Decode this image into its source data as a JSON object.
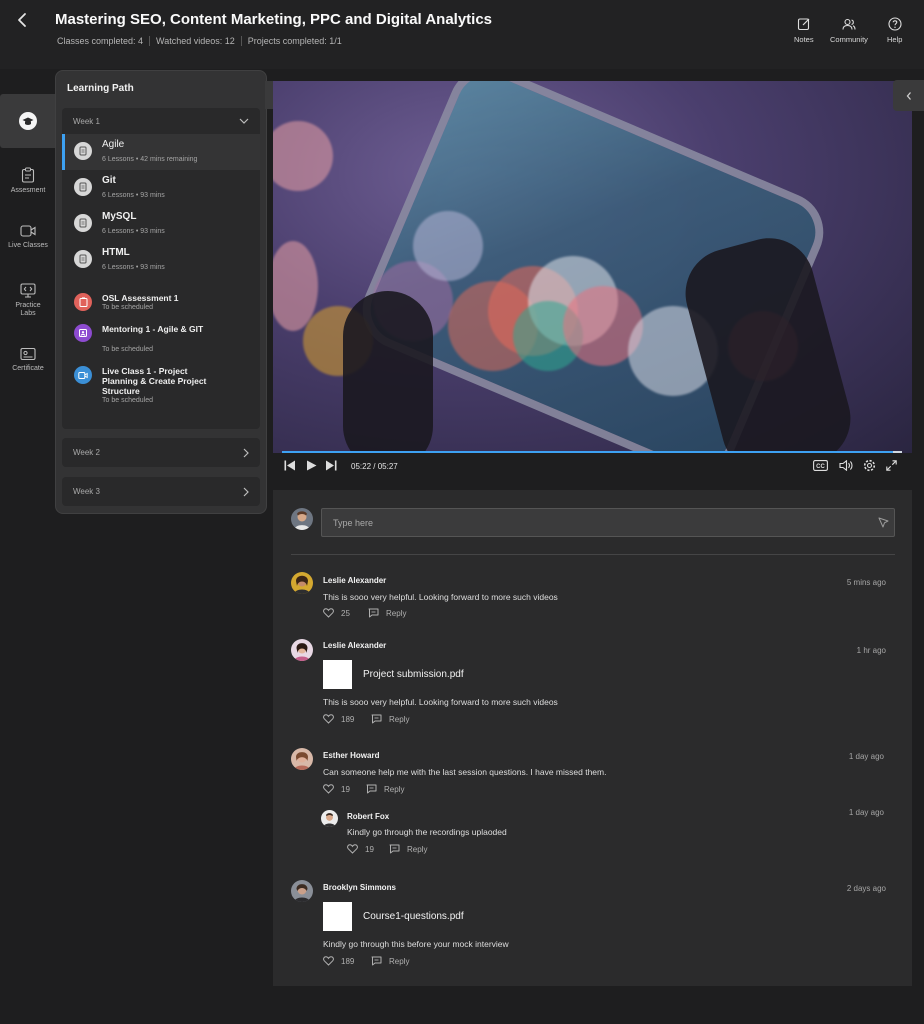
{
  "header": {
    "title": "Mastering SEO, Content Marketing, PPC and Digital Analytics",
    "stats": [
      "Classes completed: 4",
      "Watched videos: 12",
      "Projects completed: 1/1"
    ],
    "actions": [
      {
        "label": "Notes",
        "icon": "notes-icon"
      },
      {
        "label": "Community",
        "icon": "community-icon"
      },
      {
        "label": "Help",
        "icon": "help-icon"
      }
    ]
  },
  "rail": {
    "items": [
      {
        "label": "",
        "icon": "graduation-cap-icon"
      },
      {
        "label": "Assesment",
        "icon": "clipboard-icon"
      },
      {
        "label": "Live Classes",
        "icon": "video-camera-icon"
      },
      {
        "label": "Practice Labs",
        "icon": "code-monitor-icon"
      },
      {
        "label": "Certificate",
        "icon": "certificate-icon"
      }
    ]
  },
  "learning_path": {
    "title": "Learning Path",
    "week1": {
      "label": "Week 1",
      "courses": [
        {
          "name": "Agile",
          "meta": "6 Lessons  •  42 mins remaining"
        },
        {
          "name": "Git",
          "meta": "6 Lessons  •  93 mins"
        },
        {
          "name": "MySQL",
          "meta": "6 Lessons  •  93 mins"
        },
        {
          "name": "HTML",
          "meta": "6 Lessons  •  93 mins"
        }
      ],
      "tasks": [
        {
          "name": "OSL Assessment 1",
          "sub": "To be scheduled",
          "color": "#e0625b"
        },
        {
          "name": "Mentoring 1 - Agile & GIT",
          "sub": "To be scheduled",
          "color": "#8d4bd0"
        },
        {
          "name": "Live Class 1 - Project Planning & Create Project Structure",
          "sub": "To be scheduled",
          "color": "#3b8fd6"
        }
      ]
    },
    "week2": {
      "label": "Week 2"
    },
    "week3": {
      "label": "Week 3"
    }
  },
  "player": {
    "current_time": "05:22",
    "separator": "/",
    "duration": "05:27",
    "progress_fraction": 0.985,
    "accent": "#3da1f2"
  },
  "comments": {
    "input_placeholder": "Type here",
    "list": [
      {
        "author": "Leslie Alexander",
        "time": "5 mins ago",
        "text": "This is sooo very helpful. Looking forward to more such videos",
        "likes": "25",
        "reply": "Reply"
      },
      {
        "author": "Leslie Alexander",
        "time": "1 hr ago",
        "attachment": "Project submission.pdf",
        "text": "This is sooo very helpful. Looking forward to more such videos",
        "likes": "189",
        "reply": "Reply"
      },
      {
        "author": "Esther Howard",
        "time": "1 day ago",
        "text": "Can someone help me with the last session questions. I have missed them.",
        "likes": "19",
        "reply": "Reply",
        "replies": [
          {
            "author": "Robert Fox",
            "time": "1 day ago",
            "text": "Kindly go through the recordings uplaoded",
            "likes": "19",
            "reply": "Reply"
          }
        ]
      },
      {
        "author": "Brooklyn Simmons",
        "time": "2 days ago",
        "attachment": "Course1-questions.pdf",
        "text": "Kindly go through this before your mock interview",
        "likes": "189",
        "reply": "Reply"
      }
    ]
  }
}
